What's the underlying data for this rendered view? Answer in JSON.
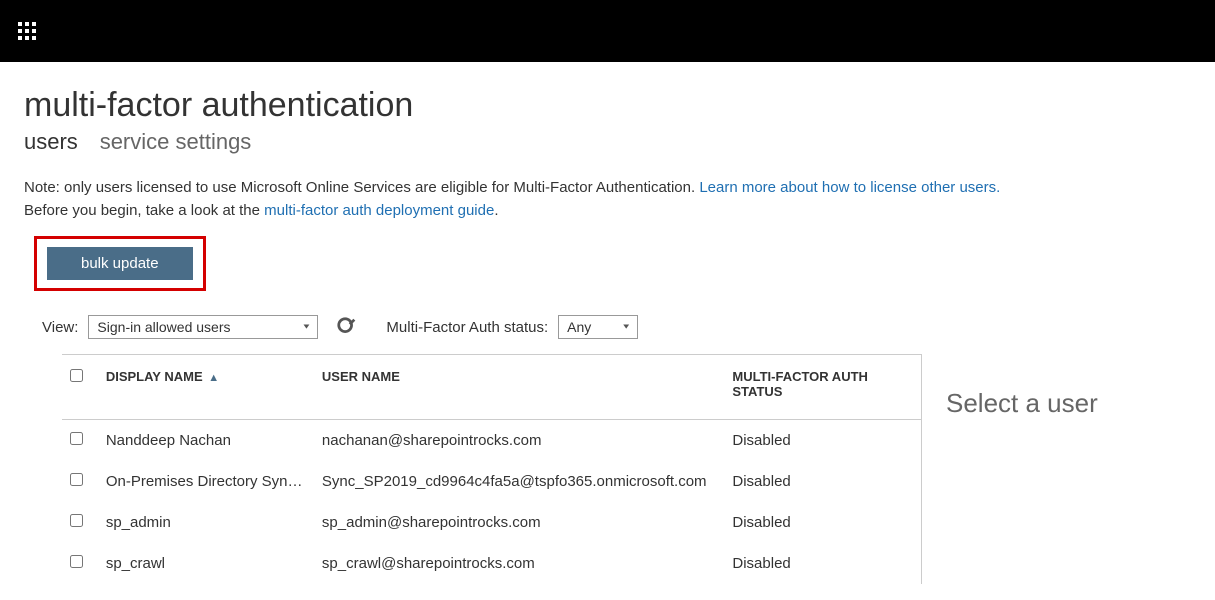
{
  "page": {
    "title": "multi-factor authentication"
  },
  "tabs": {
    "users": "users",
    "service_settings": "service settings"
  },
  "note": {
    "prefix": "Note: only users licensed to use Microsoft Online Services are eligible for Multi-Factor Authentication. ",
    "link1": "Learn more about how to license other users.",
    "line2_prefix": "Before you begin, take a look at the ",
    "link2": "multi-factor auth deployment guide",
    "line2_suffix": "."
  },
  "buttons": {
    "bulk_update": "bulk update"
  },
  "filters": {
    "view_label": "View:",
    "view_value": "Sign-in allowed users",
    "status_label": "Multi-Factor Auth status:",
    "status_value": "Any"
  },
  "table": {
    "headers": {
      "display_name": "DISPLAY NAME",
      "user_name": "USER NAME",
      "mfa_status": "MULTI-FACTOR AUTH STATUS"
    },
    "rows": [
      {
        "display_name": "Nanddeep Nachan",
        "user_name": "nachanan@sharepointrocks.com",
        "status": "Disabled"
      },
      {
        "display_name": "On-Premises Directory Synchronization",
        "user_name": "Sync_SP2019_cd9964c4fa5a@tspfo365.onmicrosoft.com",
        "status": "Disabled"
      },
      {
        "display_name": "sp_admin",
        "user_name": "sp_admin@sharepointrocks.com",
        "status": "Disabled"
      },
      {
        "display_name": "sp_crawl",
        "user_name": "sp_crawl@sharepointrocks.com",
        "status": "Disabled"
      }
    ]
  },
  "right_pane": {
    "title": "Select a user"
  }
}
